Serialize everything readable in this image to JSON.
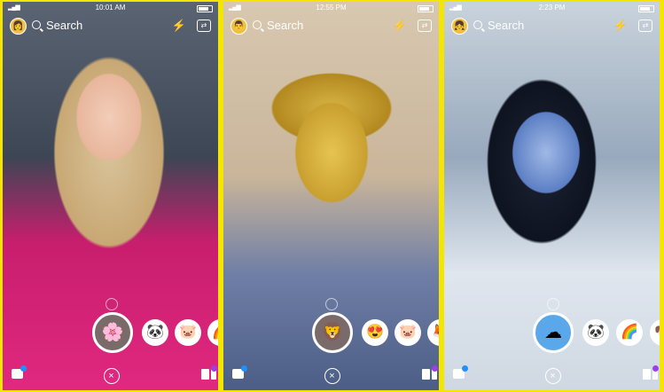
{
  "screens": [
    {
      "time": "10:01 AM",
      "search_placeholder": "Search",
      "avatar_glyph": "👩",
      "lenses": [
        "🌸",
        "🐼",
        "🐷",
        "🌈"
      ],
      "selected_lens": "🌸"
    },
    {
      "time": "12:55 PM",
      "search_placeholder": "Search",
      "avatar_glyph": "👨",
      "lenses": [
        "😍",
        "🐷",
        "🦊"
      ],
      "selected_lens": "🦁"
    },
    {
      "time": "2:23 PM",
      "search_placeholder": "Search",
      "avatar_glyph": "👧",
      "lenses": [
        "🐼",
        "🌈",
        "🐶"
      ],
      "selected_lens": "☁"
    }
  ],
  "icons": {
    "flash": "⚡",
    "flip": "⇄",
    "close": "×"
  },
  "colors": {
    "frame": "#f4e600",
    "chat_badge": "#1e90ff",
    "stories_badge": "#9b3fe8"
  }
}
